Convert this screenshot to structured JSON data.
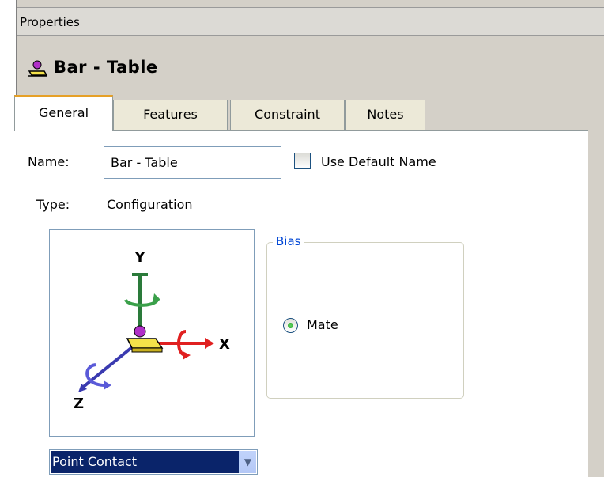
{
  "panel_title": "Properties",
  "component": {
    "title": "Bar - Table",
    "icon": "part-icon"
  },
  "tabs": [
    {
      "label": "General",
      "active": true
    },
    {
      "label": "Features",
      "active": false
    },
    {
      "label": "Constraint",
      "active": false
    },
    {
      "label": "Notes",
      "active": false
    }
  ],
  "form": {
    "name_label": "Name:",
    "name_value": "Bar - Table",
    "use_default_label": "Use Default Name",
    "use_default_checked": false,
    "type_label": "Type:",
    "type_value": "Configuration"
  },
  "axes": {
    "x": "X",
    "y": "Y",
    "z": "Z"
  },
  "bias": {
    "legend": "Bias",
    "option_label": "Mate",
    "option_selected": true
  },
  "contact_select": {
    "value": "Point Contact"
  },
  "colors": {
    "active_tab_accent": "#e6a027",
    "selection_blue": "#0a246a",
    "legend_blue": "#0046d5",
    "x_axis": "#e02020",
    "y_axis": "#2a7a3a",
    "z_axis": "#3a3ab0"
  }
}
